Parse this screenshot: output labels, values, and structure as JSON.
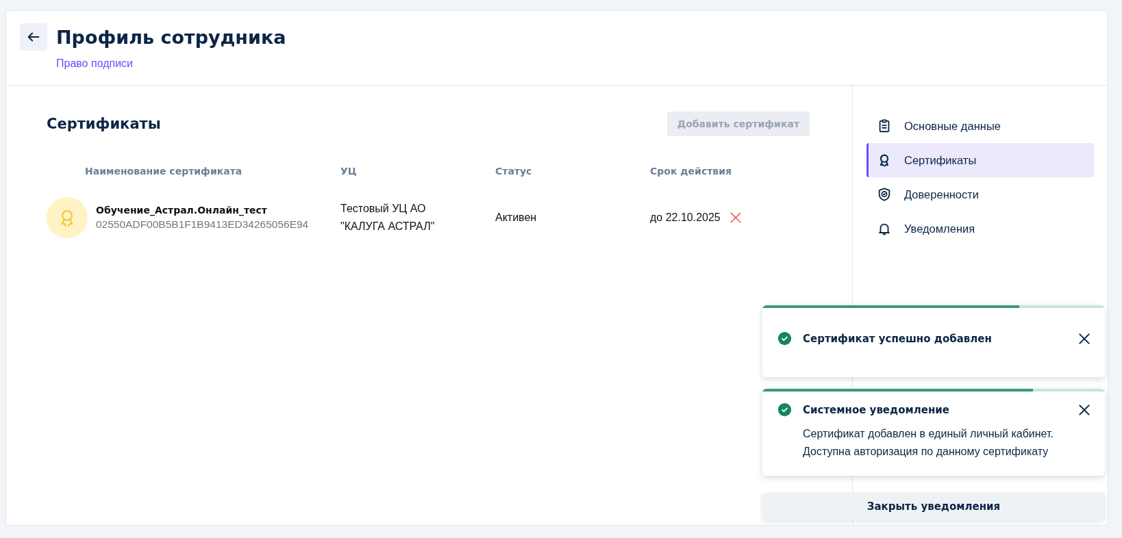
{
  "header": {
    "title": "Профиль сотрудника",
    "subtitle": "Право подписи"
  },
  "section": {
    "title": "Сертификаты",
    "add_button": {
      "label": "Добавить сертификат",
      "disabled": true
    }
  },
  "table": {
    "columns": [
      "Наименование сертификата",
      "УЦ",
      "Статус",
      "Срок действия"
    ],
    "rows": [
      {
        "name": "Обучение_Астрал.Онлайн_тест",
        "serial": "02550ADF00B5B1F1B9413ED34265056E94",
        "ca": [
          "Тестовый УЦ АО",
          "\"КАЛУГА АСТРАЛ\""
        ],
        "status": "Активен",
        "expiry": "до 22.10.2025"
      }
    ]
  },
  "sidebar": {
    "items": [
      {
        "label": "Основные данные",
        "kind": "clipboard",
        "selected": false
      },
      {
        "label": "Сертификаты",
        "kind": "award",
        "selected": true
      },
      {
        "label": "Доверенности",
        "kind": "shield",
        "selected": false
      },
      {
        "label": "Уведомления",
        "kind": "bell",
        "selected": false
      }
    ]
  },
  "toasts": [
    {
      "title": "Сертификат успешно добавлен",
      "level": 0.75
    },
    {
      "title": "Системное уведомление",
      "body": [
        "Сертификат добавлен в единый личный кабинет.",
        "Доступна авторизация по данному сертификату"
      ],
      "level": 0.79
    }
  ],
  "close_all_button": "Закрыть уведомления"
}
